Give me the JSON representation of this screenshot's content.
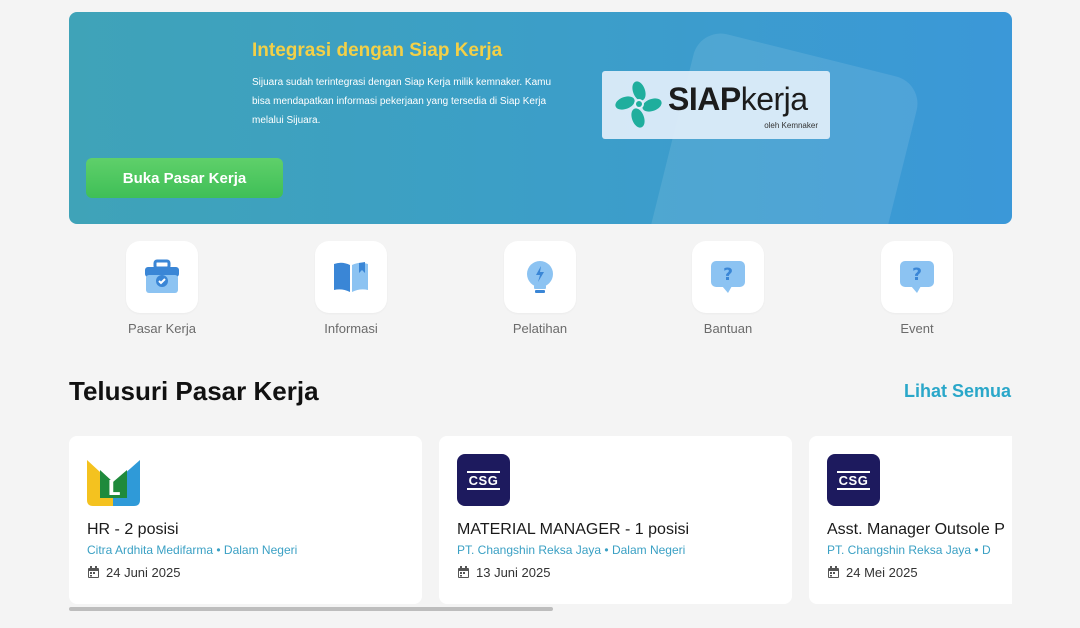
{
  "banner": {
    "title": "Integrasi dengan Siap Kerja",
    "description": "Sijuara sudah terintegrasi dengan Siap Kerja milik kemnaker. Kamu bisa mendapatkan informasi pekerjaan yang tersedia di Siap Kerja melalui Sijuara.",
    "button_label": "Buka Pasar Kerja",
    "logo": {
      "word_bold": "SIAP",
      "word_light": "kerja",
      "sub": "oleh Kemnaker"
    }
  },
  "menu": [
    {
      "label": "Pasar Kerja",
      "icon": "briefcase-check-icon"
    },
    {
      "label": "Informasi",
      "icon": "book-open-icon"
    },
    {
      "label": "Pelatihan",
      "icon": "lightbulb-icon"
    },
    {
      "label": "Bantuan",
      "icon": "help-chat-icon"
    },
    {
      "label": "Event",
      "icon": "help-chat-icon"
    }
  ],
  "section": {
    "title": "Telusuri Pasar Kerja",
    "see_all": "Lihat Semua"
  },
  "cards": [
    {
      "logo": "L",
      "title": "HR - 2 posisi",
      "company": "Citra Ardhita Medifarma • Dalam Negeri",
      "date": "24 Juni 2025"
    },
    {
      "logo": "CSG",
      "title": "MATERIAL MANAGER - 1 posisi",
      "company": "PT. Changshin Reksa Jaya • Dalam Negeri",
      "date": "13 Juni 2025"
    },
    {
      "logo": "CSG",
      "title": "Asst. Manager Outsole P",
      "company": "PT. Changshin Reksa Jaya • D",
      "date": "24 Mei 2025"
    }
  ],
  "colors": {
    "accent": "#2aa7c9",
    "banner_title": "#f3d047",
    "button_green": "#4cc55e",
    "csg_navy": "#1d1a5e"
  }
}
